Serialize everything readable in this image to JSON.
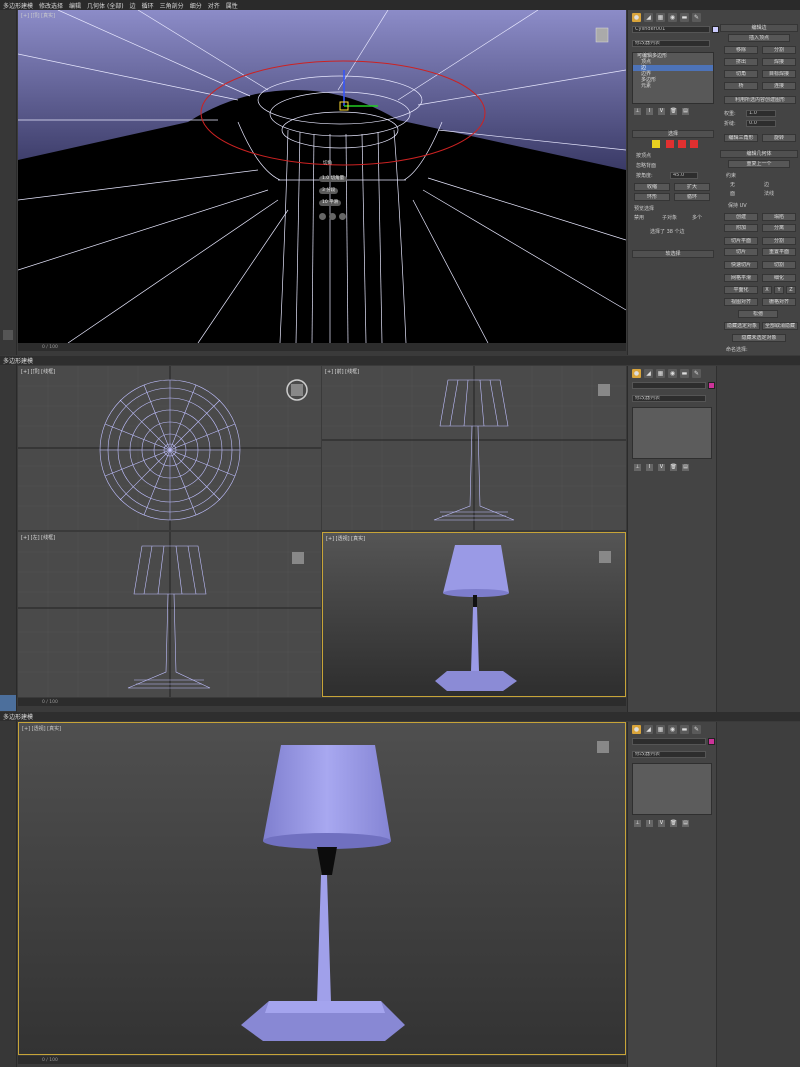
{
  "top": {
    "menu": [
      "多边形建模",
      "修改选择",
      "编辑",
      "几何体 (全部)",
      "边",
      "循环",
      "三角剖分",
      "细分",
      "对齐",
      "属性"
    ],
    "viewport_label": "[+] [顶] [真实]",
    "timeline": "0 / 100",
    "quad_menu": {
      "title": "切角",
      "options": [
        "切角量",
        "分段",
        "平滑"
      ],
      "values": [
        "1.0",
        "3",
        "10"
      ]
    },
    "command_panel": {
      "tabs": [
        "create-icon",
        "modify-icon",
        "hierarchy-icon",
        "motion-icon",
        "display-icon",
        "utilities-icon"
      ],
      "object_name": "Cylinder001",
      "object_color": "#ccccff",
      "modifier_list": "修改器列表",
      "stack": [
        "可编辑多边形",
        "顶点",
        "边",
        "边界",
        "多边形",
        "元素"
      ],
      "stack_selected_index": 2,
      "selection_rollout": "选择",
      "sel_checks": [
        "按顶点",
        "忽略背面",
        "按角度:"
      ],
      "angle_value": "45.0",
      "sel_btns": [
        "收缩",
        "扩大",
        "环形",
        "循环"
      ],
      "preview_label": "预览选择",
      "preview_opts": [
        "禁用",
        "子对象",
        "多个"
      ],
      "status": "选择了 38 个边",
      "soft_sel": "软选择",
      "edit_edges": "编辑边",
      "insert_vertex": "插入顶点",
      "edge_btns": [
        "移除",
        "分割",
        "挤出",
        "焊接",
        "切角",
        "目标焊接",
        "桥",
        "连接"
      ],
      "create_shape_btn": "利用所选内容创建图形",
      "weight_label": "权重:",
      "weight_value": "1.0",
      "crease_label": "折缝:",
      "crease_value": "0.0",
      "edit_tri_btn": "编辑三角形",
      "rotate_btn": "旋转",
      "edit_geom": "编辑几何体",
      "repeat_last": "重复上一个",
      "constraint_label": "约束",
      "constraints": [
        "无",
        "边",
        "面",
        "法线"
      ],
      "preserve_uv": "保持 UV",
      "geom_btns": [
        "创建",
        "塌陷",
        "附加",
        "分离",
        "切片平面",
        "分割",
        "切片",
        "重置平面",
        "快速切片",
        "切割",
        "网格平滑",
        "细化",
        "平面化",
        "X",
        "Y",
        "Z",
        "视图对齐",
        "栅格对齐",
        "松弛"
      ],
      "hide_btns": [
        "隐藏选定对象",
        "全部取消隐藏",
        "隐藏未选定对象"
      ],
      "named_sel": "命名选择:"
    }
  },
  "middle": {
    "menu": [
      "多边形建模"
    ],
    "views": [
      "[+] [顶] [线框]",
      "[+] [前] [线框]",
      "[+] [左] [线框]",
      "[+] [透视] [真实]"
    ],
    "timeline": "0 / 100",
    "command_panel": {
      "modifier_list": "修改器列表",
      "object_color": "#cc3399"
    }
  },
  "bottom": {
    "menu": [
      "多边形建模"
    ],
    "viewport_label": "[+] [透视] [真实]",
    "timeline": "0 / 100",
    "command_panel": {
      "modifier_list": "修改器列表",
      "object_color": "#cc3399"
    }
  },
  "colors": {
    "lamp": "#9a9ae6",
    "lamp_dark": "#6b6bb8",
    "wire": "#b8b8ff",
    "viewport_bg": "#4a4a4a"
  }
}
